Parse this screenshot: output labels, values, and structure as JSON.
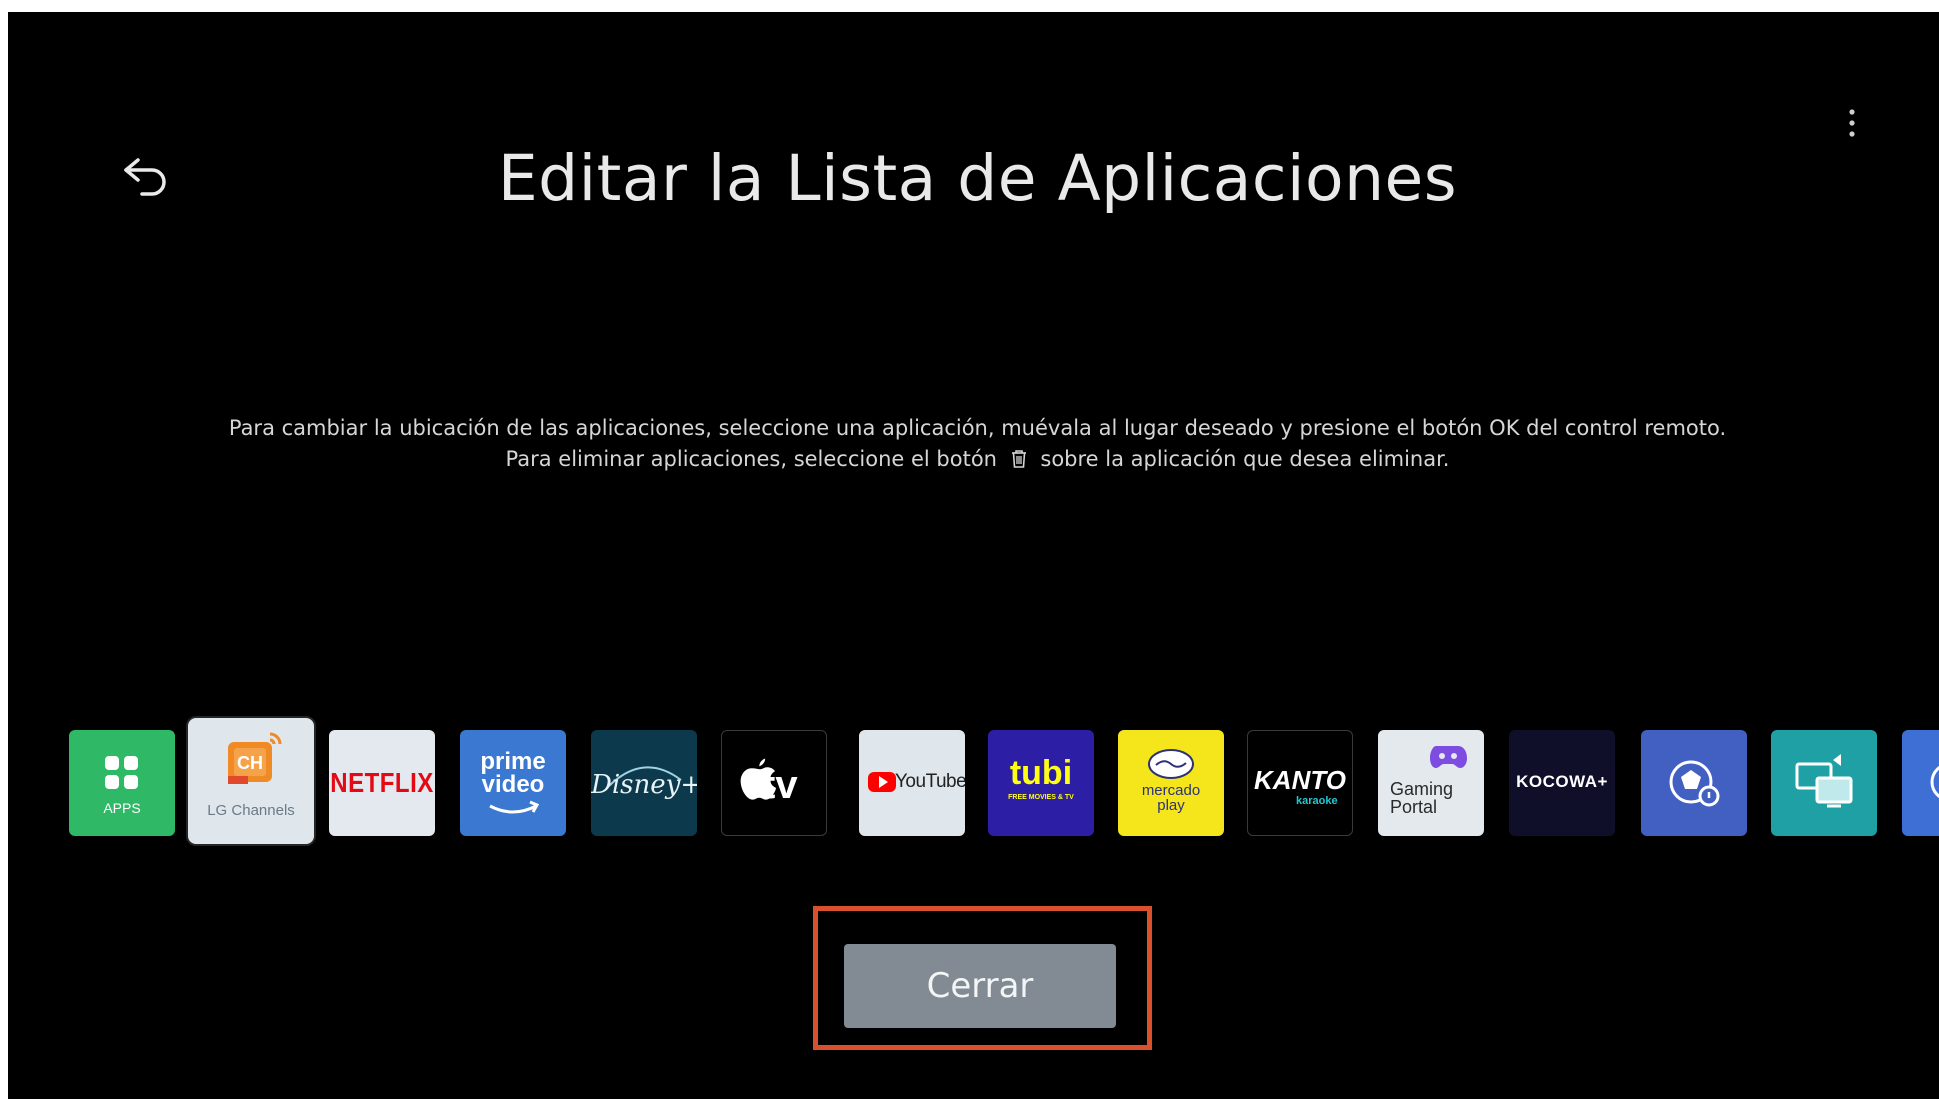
{
  "page": {
    "title": "Editar la Lista de Aplicaciones",
    "instructions_line1": "Para cambiar la ubicación de las aplicaciones, seleccione una aplicación, muévala al lugar deseado y presione el botón OK del control remoto.",
    "instructions_line2_before": "Para eliminar aplicaciones, seleccione el botón",
    "instructions_line2_after": "sobre la aplicación que desea eliminar."
  },
  "header": {
    "back_icon": "back-arrow-icon",
    "more_icon": "more-vertical-icon"
  },
  "apps": [
    {
      "name": "APPS",
      "label": "APPS",
      "icon": "apps-grid-icon",
      "color": "#2fb865"
    },
    {
      "name": "LG Channels",
      "label": "LG Channels",
      "icon": "lg-channels-icon",
      "color": "#dfe6ec",
      "focused": true
    },
    {
      "name": "Netflix",
      "label": "NETFLIX",
      "icon": "netflix-logo",
      "color": "#e3e9ee"
    },
    {
      "name": "Prime Video",
      "label_line1": "prime",
      "label_line2": "video",
      "icon": "prime-video-logo",
      "color": "#3b78d1"
    },
    {
      "name": "Disney+",
      "label": "Disney+",
      "icon": "disney-plus-logo",
      "color": "#0c3a4c"
    },
    {
      "name": "Apple TV",
      "label": "tv",
      "icon": "apple-tv-logo",
      "color": "#000000"
    },
    {
      "name": "YouTube",
      "label": "YouTube",
      "icon": "youtube-logo",
      "color": "#dfe6ec"
    },
    {
      "name": "Tubi",
      "label": "tubi",
      "sublabel": "FREE MOVIES & TV",
      "icon": "tubi-logo",
      "color": "#2d1ea6"
    },
    {
      "name": "Mercado Play",
      "label_line1": "mercado",
      "label_line2": "play",
      "icon": "mercado-play-logo",
      "color": "#f4e61a"
    },
    {
      "name": "Kanto",
      "label": "KANTO",
      "sublabel": "karaoke",
      "icon": "kanto-karaoke-logo",
      "color": "#000000"
    },
    {
      "name": "Gaming Portal",
      "label_line1": "Gaming",
      "label_line2": "Portal",
      "icon": "gaming-portal-icon",
      "color": "#e4e9ee"
    },
    {
      "name": "KOCOWA+",
      "label": "KOCOWA+",
      "icon": "kocowa-logo",
      "color": "#0f0f2a"
    },
    {
      "name": "Sports Alert",
      "icon": "sports-ball-bell-icon",
      "color": "#4160c2"
    },
    {
      "name": "Screen Share",
      "icon": "screen-share-icon",
      "color": "#1fa0a4"
    },
    {
      "name": "Partial App",
      "icon": "clock-icon",
      "color": "#3d6fd4"
    }
  ],
  "close_button": {
    "label": "Cerrar",
    "highlight_color": "#d9502c"
  }
}
